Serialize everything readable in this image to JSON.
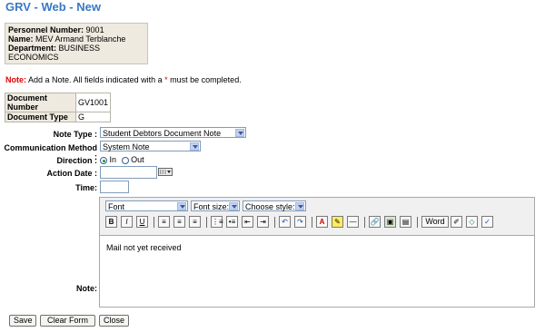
{
  "title": "GRV - Web - New",
  "person": {
    "number_label": "Personnel Number:",
    "number_value": "9001",
    "name_label": "Name:",
    "name_value": "MEV Armand Terblanche",
    "dept_label": "Department:",
    "dept_value": "BUSINESS ECONOMICS"
  },
  "note_msg": {
    "prefix": "Note:",
    "text": "Add a Note. All fields indicated with a",
    "star": "*",
    "suffix": "must be completed."
  },
  "document": {
    "number_label": "Document Number",
    "number_value": "GV1001",
    "type_label": "Document Type",
    "type_value": "G"
  },
  "form": {
    "note_type_label": "Note Type :",
    "note_type_value": "Student Debtors Document Note",
    "comm_method_label": "Communication Method :",
    "comm_method_value": "System Note",
    "direction_label": "Direction :",
    "direction_in": "In",
    "direction_out": "Out",
    "direction_selected": "In",
    "action_date_label": "Action Date :",
    "action_date_value": "",
    "time_label": "Time:",
    "time_value": "",
    "note_label": "Note:"
  },
  "editor": {
    "font": "Font",
    "font_size": "Font size:",
    "style": "Choose style:",
    "word_button": "Word",
    "content": "Mail not yet received",
    "icons": [
      "bold-icon",
      "italic-icon",
      "underline-icon",
      "align-left-icon",
      "align-center-icon",
      "align-right-icon",
      "ordered-list-icon",
      "unordered-list-icon",
      "outdent-icon",
      "indent-icon",
      "undo-icon",
      "redo-icon",
      "font-color-icon",
      "highlight-icon",
      "horizontal-rule-icon",
      "link-icon",
      "image-icon",
      "table-icon",
      "word-paste-icon",
      "clean-icon",
      "html-source-icon",
      "spellcheck-icon"
    ]
  },
  "buttons": {
    "save": "Save",
    "clear": "Clear Form",
    "close": "Close"
  },
  "colors": {
    "title": "#3a78c4",
    "note_red": "#e00000",
    "info_bg": "#eeeae0"
  }
}
